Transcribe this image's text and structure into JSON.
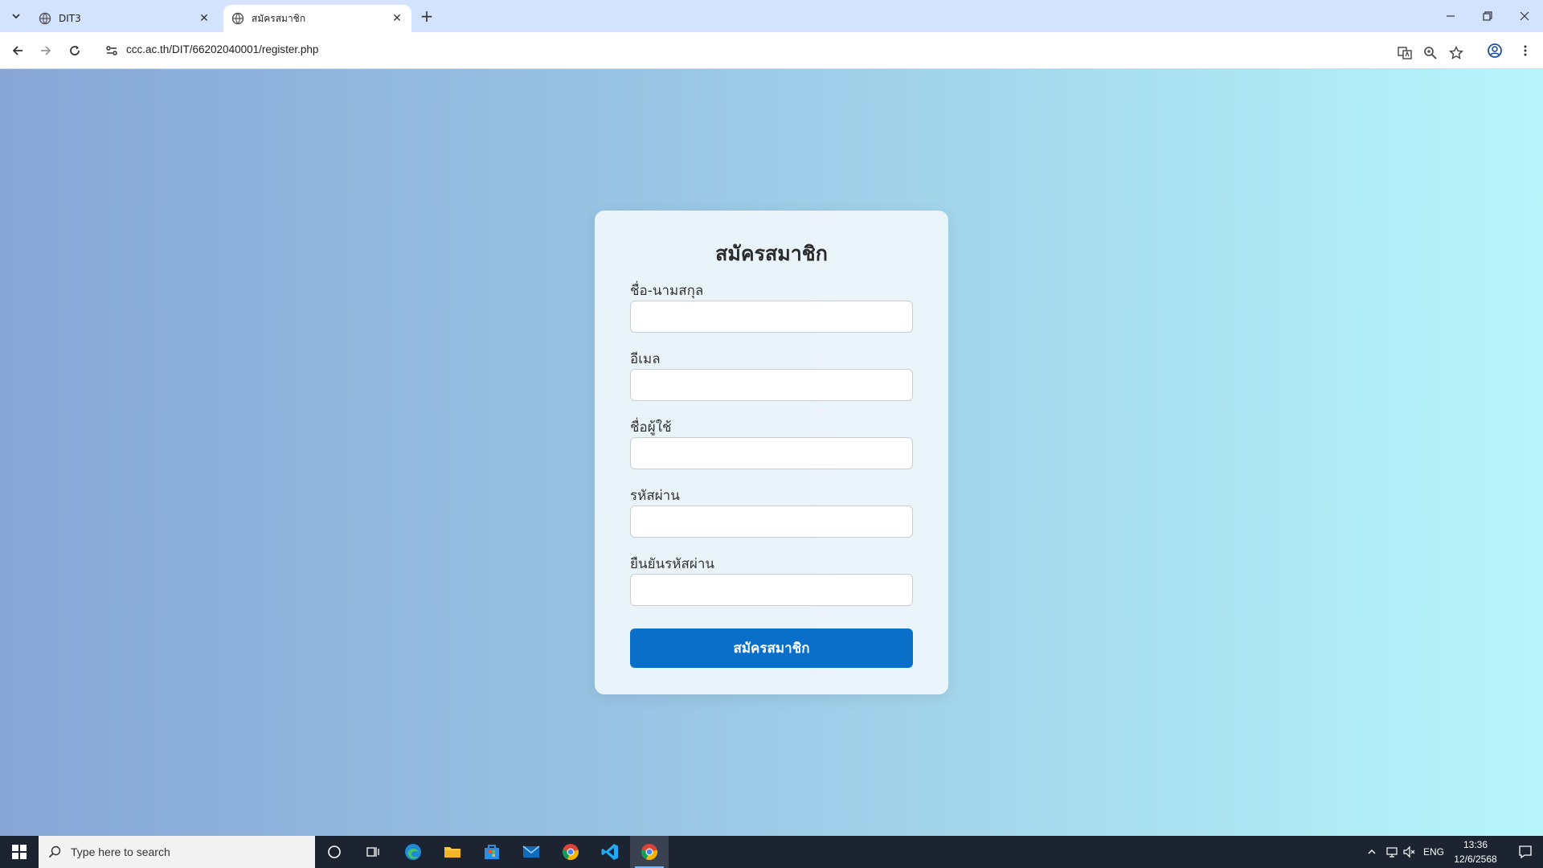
{
  "browser": {
    "tabs": [
      {
        "title": "DIT3",
        "active": false
      },
      {
        "title": "สมัครสมาชิก",
        "active": true
      }
    ],
    "url": "ccc.ac.th/DIT/66202040001/register.php"
  },
  "form": {
    "heading": "สมัครสมาชิก",
    "fields": [
      {
        "label": "ชื่อ-นามสกุล",
        "value": ""
      },
      {
        "label": "อีเมล",
        "value": ""
      },
      {
        "label": "ชื่อผู้ใช้",
        "value": ""
      },
      {
        "label": "รหัสผ่าน",
        "value": ""
      },
      {
        "label": "ยืนยันรหัสผ่าน",
        "value": ""
      }
    ],
    "submit_label": "สมัครสมาชิก"
  },
  "taskbar": {
    "search_placeholder": "Type here to search",
    "language": "ENG",
    "time": "13:36",
    "date": "12/6/2568"
  },
  "colors": {
    "accent": "#0a6fc8",
    "tabbar": "#d3e3fd",
    "taskbar": "#1c2331"
  }
}
